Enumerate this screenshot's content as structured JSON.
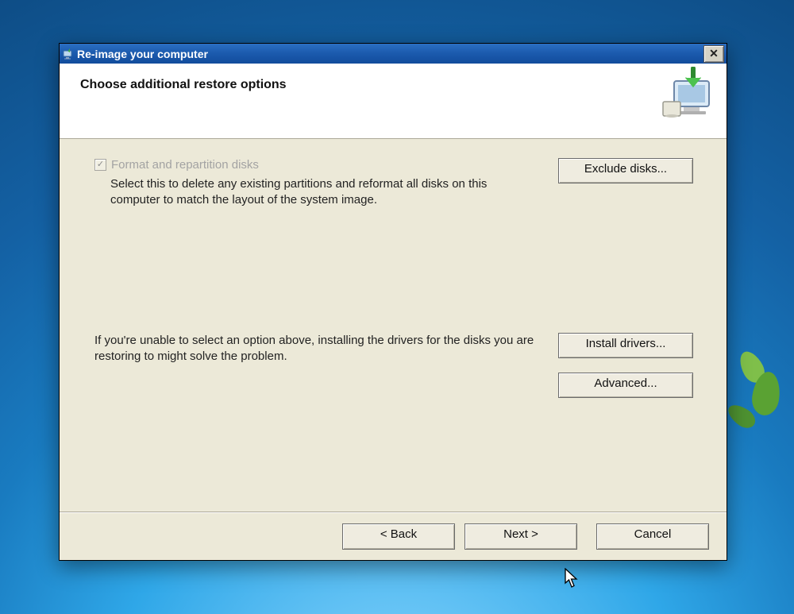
{
  "titlebar": {
    "title": "Re-image your computer"
  },
  "header": {
    "heading": "Choose additional restore options"
  },
  "checkbox": {
    "label": "Format and repartition disks",
    "checked_glyph": "✓",
    "description": "Select this to delete any existing partitions and reformat all disks on this computer to match the layout of the system image."
  },
  "drivers_hint": "If you're unable to select an option above, installing the drivers for the disks you are restoring to might solve the problem.",
  "buttons": {
    "exclude": "Exclude disks...",
    "install": "Install drivers...",
    "advanced": "Advanced...",
    "back": "< Back",
    "next": "Next >",
    "cancel": "Cancel"
  },
  "close_glyph": "✕"
}
